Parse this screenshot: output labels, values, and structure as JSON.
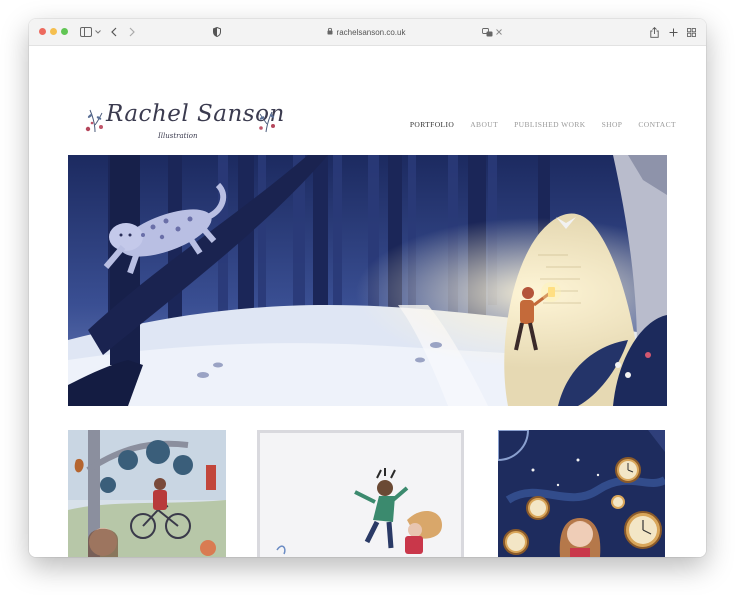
{
  "browser": {
    "url": "rachelsanson.co.uk"
  },
  "site": {
    "logo_title": "Rachel Sanson",
    "logo_subtitle": "Illustration"
  },
  "nav": {
    "items": [
      {
        "label": "PORTFOLIO",
        "active": true
      },
      {
        "label": "ABOUT",
        "active": false
      },
      {
        "label": "PUBLISHED WORK",
        "active": false
      },
      {
        "label": "SHOP",
        "active": false
      },
      {
        "label": "CONTACT",
        "active": false
      }
    ]
  },
  "colors": {
    "nav_active": "#333333",
    "nav_inactive": "#9a9a9a",
    "logo_ink": "#3b3b4f",
    "hero_night_blue": "#1f2f66",
    "thumb3_navy": "#1e2c5e"
  },
  "icons": {
    "sidebar_toggle": "sidebar-icon",
    "back": "chevron-left-icon",
    "forward": "chevron-right-icon",
    "privacy": "shield-icon",
    "share": "share-icon",
    "new_tab": "plus-icon",
    "tab_overview": "grid-icon"
  }
}
